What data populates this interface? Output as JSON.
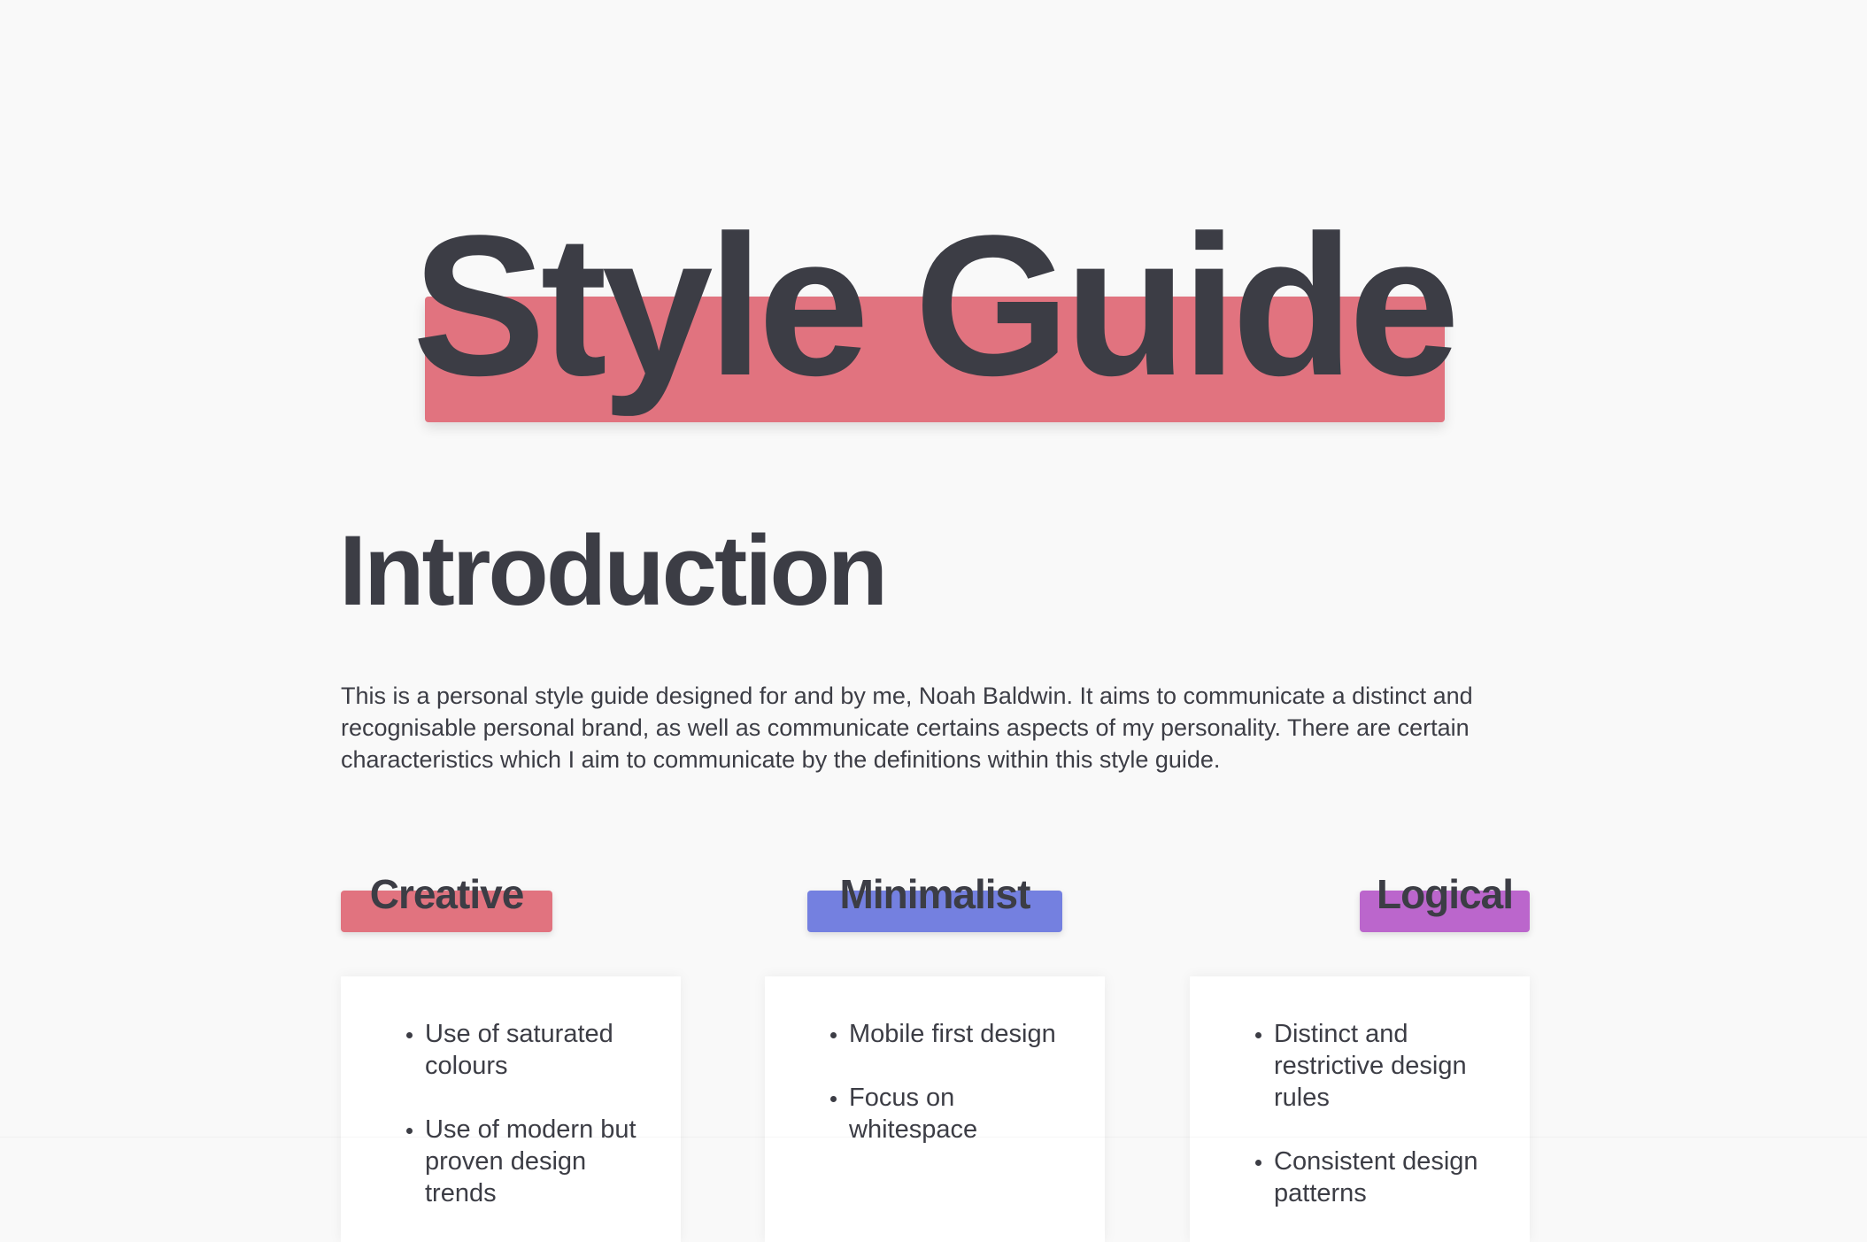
{
  "colors": {
    "text": "#3c3d45",
    "creative": "#e1737f",
    "minimalist": "#7480e0",
    "logical": "#bb66cc",
    "background": "#f9f9f9"
  },
  "header": {
    "title": "Style Guide"
  },
  "intro": {
    "heading": "Introduction",
    "paragraph": "This is a personal style guide designed for and by me, Noah Baldwin. It aims to communicate a distinct and recognisable personal brand, as well as communicate certains aspects of my personality. There are certain characteristics which I aim to communicate by the definitions within this style guide."
  },
  "traits": [
    {
      "label": "Creative",
      "items": [
        "Use of saturated colours",
        "Use of modern but proven design trends"
      ]
    },
    {
      "label": "Minimalist",
      "items": [
        "Mobile first design",
        "Focus on whitespace"
      ]
    },
    {
      "label": "Logical",
      "items": [
        "Distinct and restrictive design rules",
        "Consistent design patterns"
      ]
    }
  ]
}
